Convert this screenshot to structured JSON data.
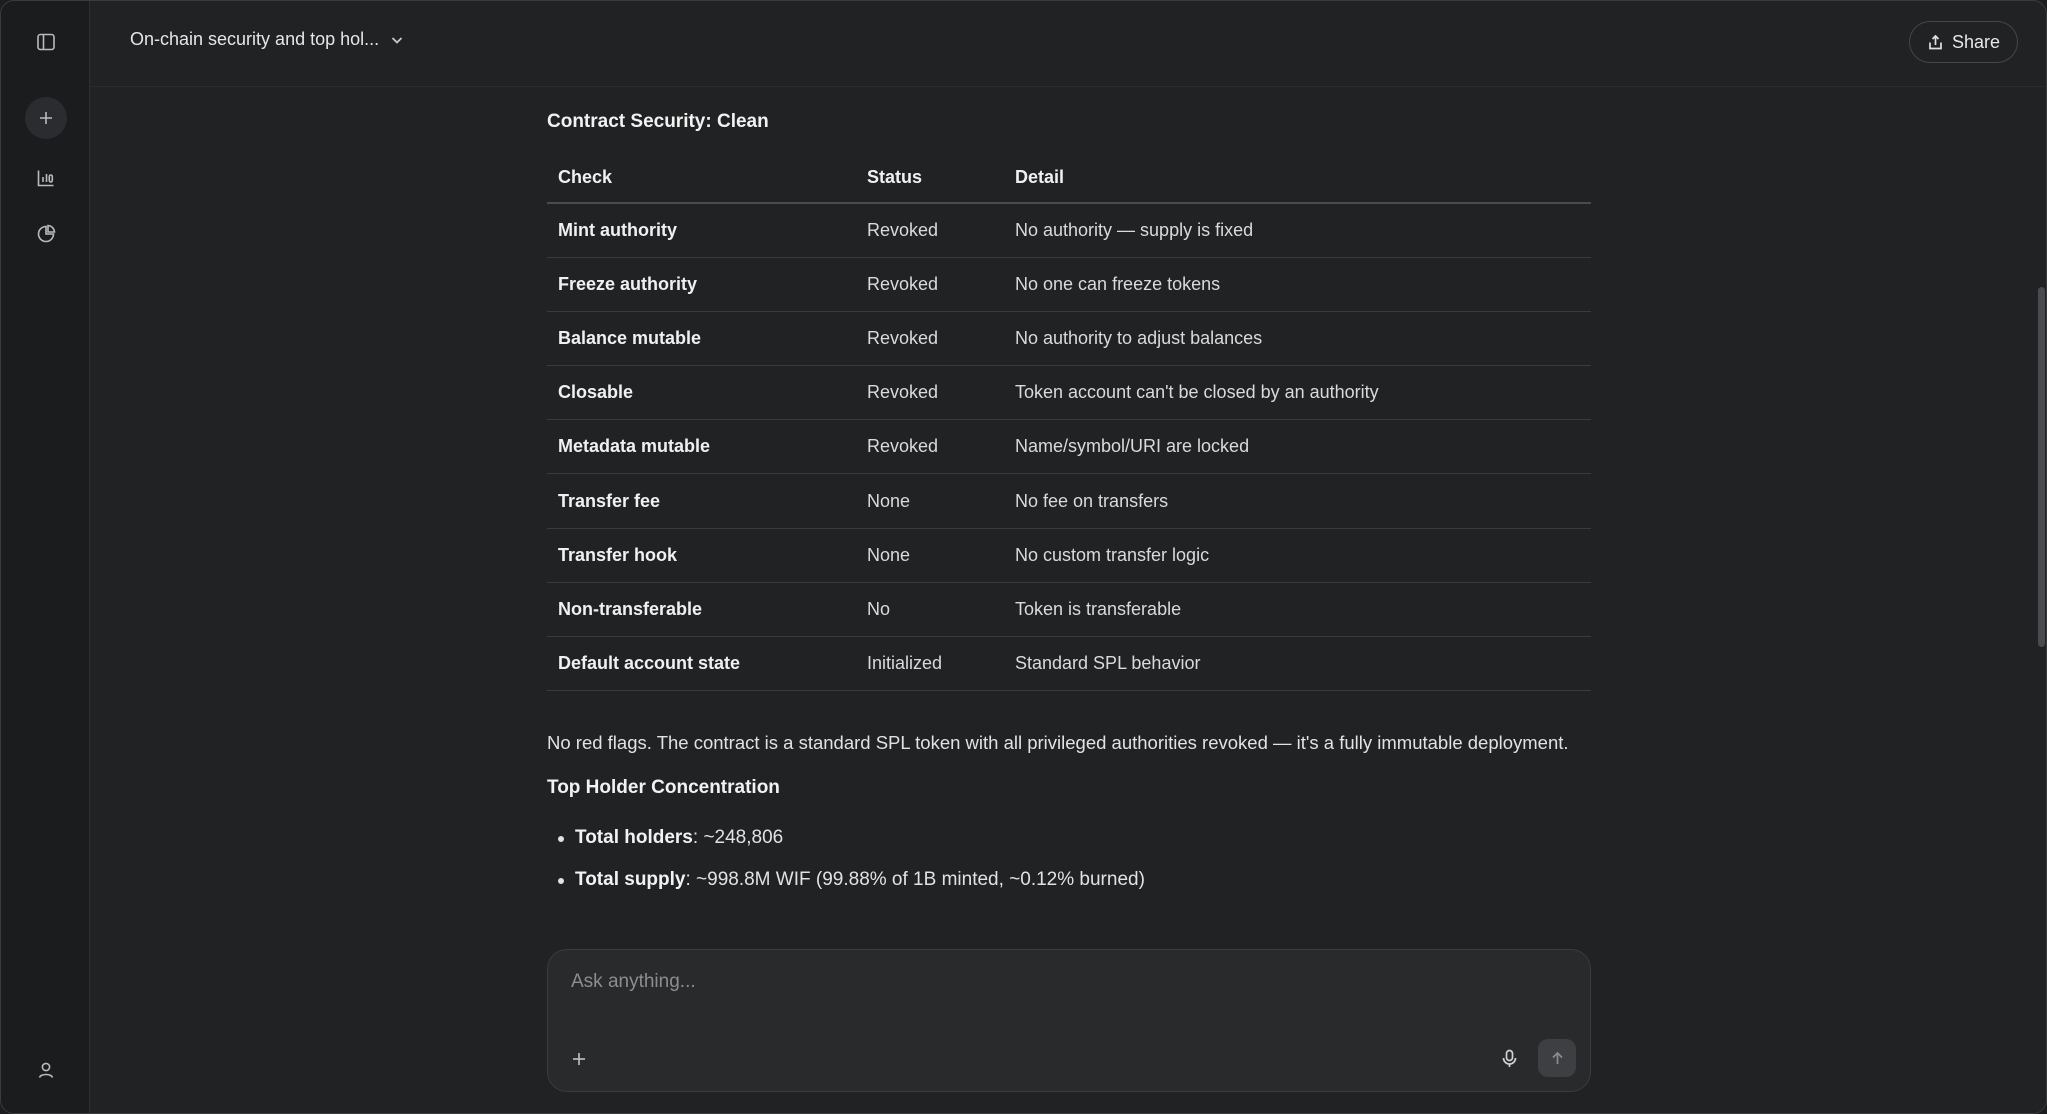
{
  "conversation": {
    "title": "On-chain security and top hol..."
  },
  "header": {
    "share_label": "Share"
  },
  "rail": {
    "icons": [
      "sidebar-toggle-icon",
      "plus-icon",
      "chart-icon",
      "pie-chart-icon",
      "user-icon"
    ]
  },
  "section1": {
    "title": "Contract Security: Clean",
    "headers": [
      "Check",
      "Status",
      "Detail"
    ],
    "rows": [
      {
        "check": "Mint authority",
        "status": "Revoked",
        "detail": "No authority — supply is fixed"
      },
      {
        "check": "Freeze authority",
        "status": "Revoked",
        "detail": "No one can freeze tokens"
      },
      {
        "check": "Balance mutable",
        "status": "Revoked",
        "detail": "No authority to adjust balances"
      },
      {
        "check": "Closable",
        "status": "Revoked",
        "detail": "Token account can't be closed by an authority"
      },
      {
        "check": "Metadata mutable",
        "status": "Revoked",
        "detail": "Name/symbol/URI are locked"
      },
      {
        "check": "Transfer fee",
        "status": "None",
        "detail": "No fee on transfers"
      },
      {
        "check": "Transfer hook",
        "status": "None",
        "detail": "No custom transfer logic"
      },
      {
        "check": "Non-transferable",
        "status": "No",
        "detail": "Token is transferable"
      },
      {
        "check": "Default account state",
        "status": "Initialized",
        "detail": "Standard SPL behavior"
      }
    ],
    "summary": "No red flags. The contract is a standard SPL token with all privileged authorities revoked — it's a fully immutable deployment."
  },
  "section2": {
    "title": "Top Holder Concentration",
    "bullets": [
      {
        "label": "Total holders",
        "value": ": ~248,806"
      },
      {
        "label": "Total supply",
        "value": ": ~998.8M WIF (99.88% of 1B minted, ~0.12% burned)"
      }
    ]
  },
  "composer": {
    "placeholder": "Ask anything..."
  }
}
